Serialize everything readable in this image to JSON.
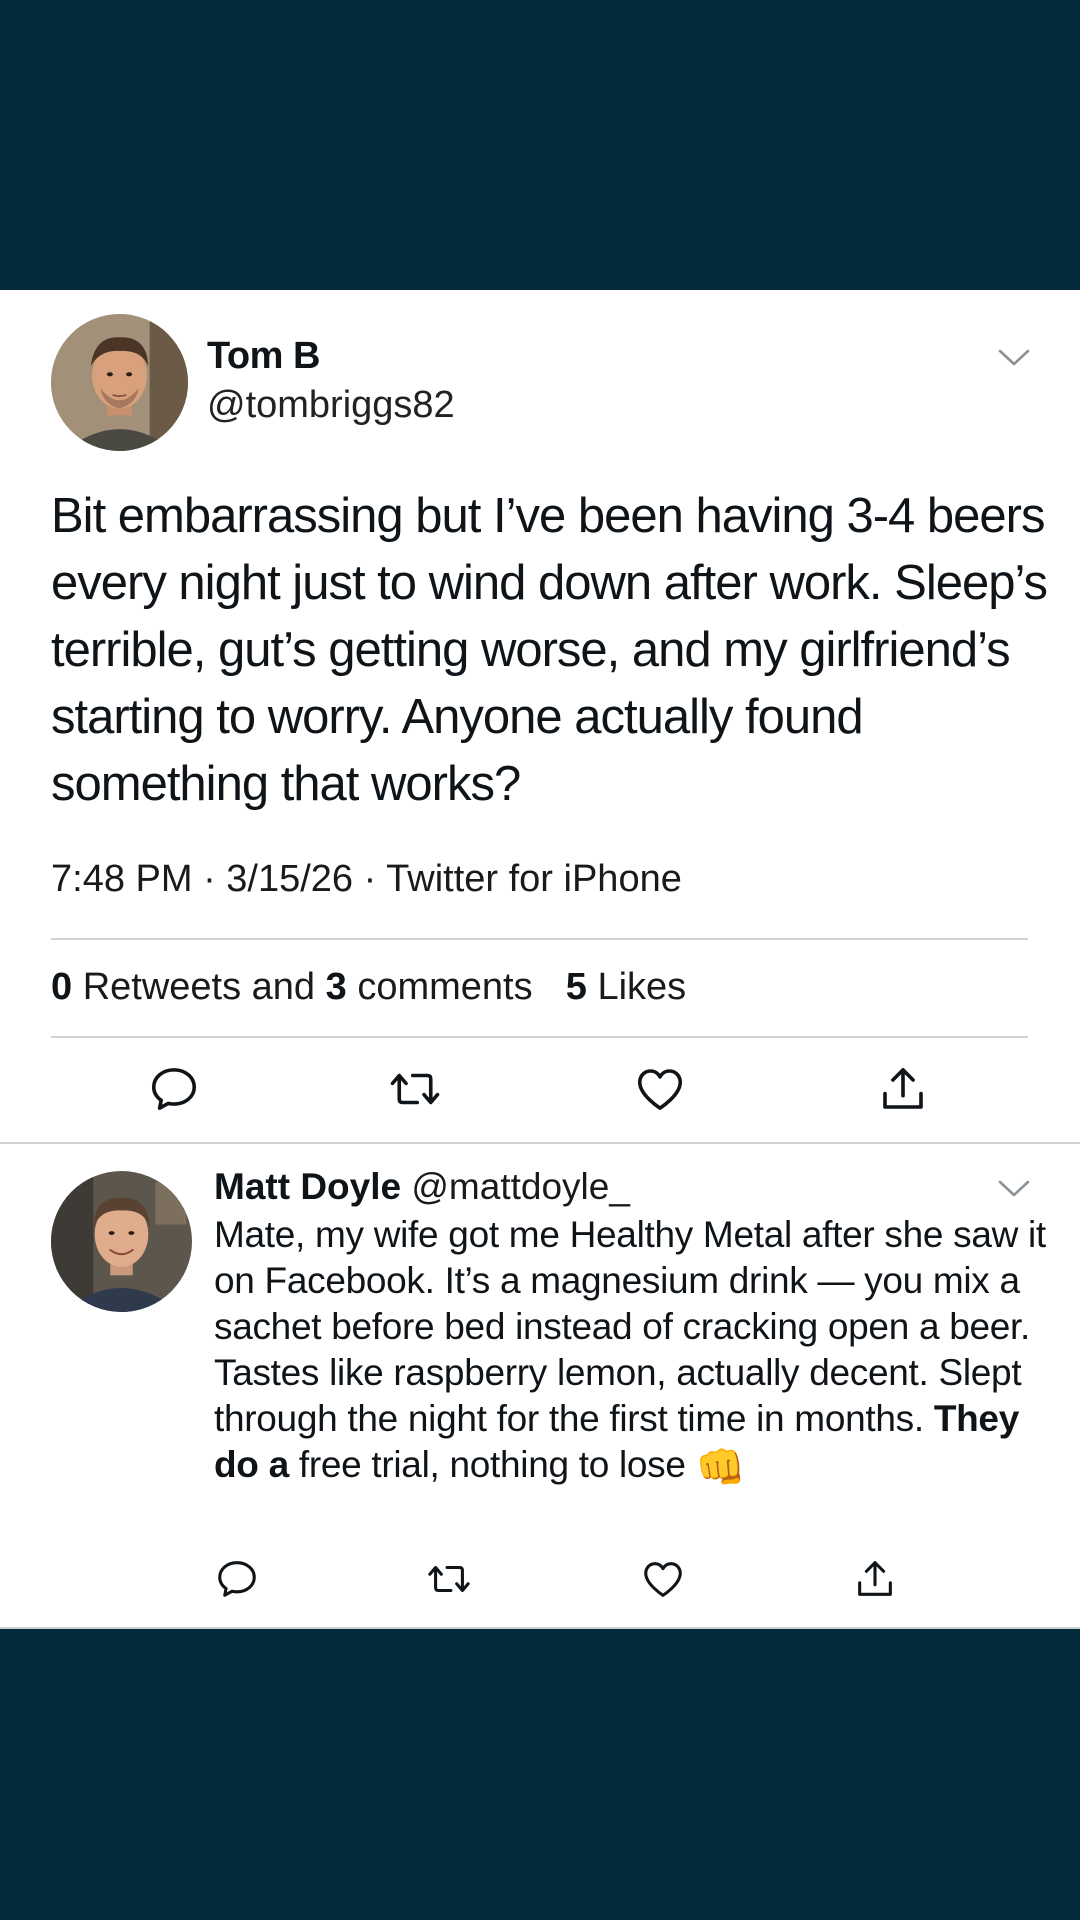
{
  "colors": {
    "page_background": "#032a3b",
    "card_background": "#ffffff",
    "text": "#0f1419",
    "divider": "#cfd3d6"
  },
  "tweet": {
    "avatar_icon": "profile-photo",
    "name": "Tom B",
    "handle": "@tombriggs82",
    "menu_icon": "chevron-down-icon",
    "text": "Bit embarrassing but I’ve been having 3-4 beers every night just to wind down after work. Sleep’s terrible, gut’s getting worse, and my girlfriend’s starting to worry. Anyone actually found something that works?",
    "meta": "7:48 PM · 3/15/26 · Twitter for iPhone",
    "stats": {
      "retweets_count": "0",
      "retweets_label": "Retweets and",
      "comments_count": "3",
      "comments_label": "comments",
      "likes_count": "5",
      "likes_label": "Likes"
    },
    "actions": [
      "reply-icon",
      "retweet-icon",
      "like-icon",
      "share-icon"
    ]
  },
  "reply": {
    "avatar_icon": "profile-photo",
    "name": "Matt Doyle",
    "handle": "@mattdoyle_",
    "menu_icon": "chevron-down-icon",
    "text_part1": "Mate, my wife got me Healthy Metal after she saw it on Facebook. It’s a magnesium drink — you mix a sachet before bed instead of cracking open a beer. Tastes like raspberry lemon, actually decent. Slept through the night for the first time in months. ",
    "text_bold": "They do a",
    "text_part2": " free trial, nothing to lose ",
    "emoji": "👊",
    "actions": [
      "reply-icon",
      "retweet-icon",
      "like-icon",
      "share-icon"
    ]
  }
}
